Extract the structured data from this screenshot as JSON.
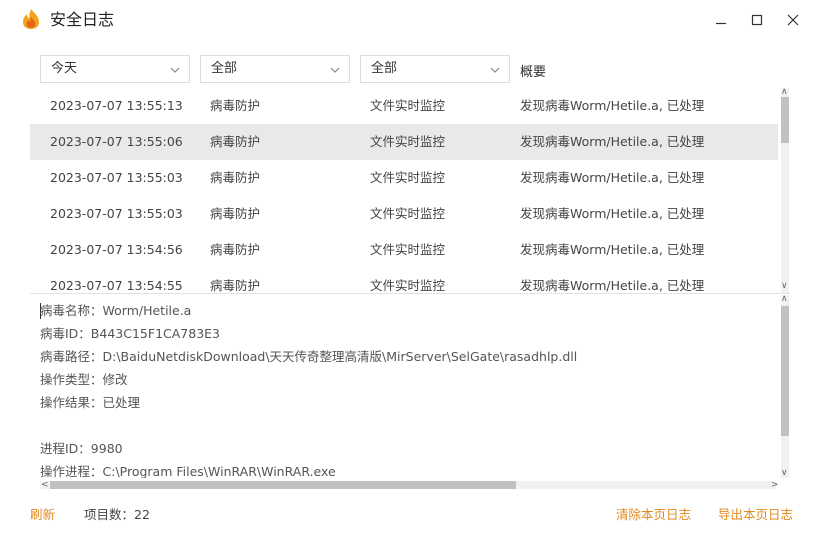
{
  "window": {
    "title": "安全日志"
  },
  "filters": {
    "date": "今天",
    "type": "全部",
    "source": "全部",
    "overview_label": "概要"
  },
  "log_rows": [
    {
      "time": "2023-07-07 13:55:13",
      "module": "病毒防护",
      "source": "文件实时监控",
      "summary": "发现病毒Worm/Hetile.a, 已处理"
    },
    {
      "time": "2023-07-07 13:55:06",
      "module": "病毒防护",
      "source": "文件实时监控",
      "summary": "发现病毒Worm/Hetile.a, 已处理"
    },
    {
      "time": "2023-07-07 13:55:03",
      "module": "病毒防护",
      "source": "文件实时监控",
      "summary": "发现病毒Worm/Hetile.a, 已处理"
    },
    {
      "time": "2023-07-07 13:55:03",
      "module": "病毒防护",
      "source": "文件实时监控",
      "summary": "发现病毒Worm/Hetile.a, 已处理"
    },
    {
      "time": "2023-07-07 13:54:56",
      "module": "病毒防护",
      "source": "文件实时监控",
      "summary": "发现病毒Worm/Hetile.a, 已处理"
    },
    {
      "time": "2023-07-07 13:54:55",
      "module": "病毒防护",
      "source": "文件实时监控",
      "summary": "发现病毒Worm/Hetile.a, 已处理"
    }
  ],
  "selected_row": 1,
  "detail": {
    "lines": [
      "病毒名称：Worm/Hetile.a",
      "病毒ID：B443C15F1CA783E3",
      "病毒路径：D:\\BaiduNetdiskDownload\\天天传奇整理高清版\\MirServer\\SelGate\\rasadhlp.dll",
      "操作类型：修改",
      "操作结果：已处理",
      "",
      "进程ID：9980",
      "操作进程：C:\\Program Files\\WinRAR\\WinRAR.exe"
    ]
  },
  "footer": {
    "refresh": "刷新",
    "item_count": "项目数：22",
    "clear_page": "清除本页日志",
    "export_page": "导出本页日志"
  },
  "colors": {
    "accent": "#e08a1e",
    "selected_row": "#e9e9e9",
    "scroll_thumb": "#c1c1c1"
  }
}
